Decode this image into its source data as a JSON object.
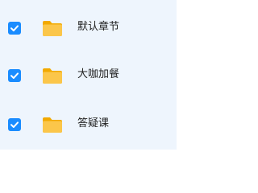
{
  "items": [
    {
      "label": "默认章节",
      "checked": true,
      "icon": "folder-icon"
    },
    {
      "label": "大咖加餐",
      "checked": true,
      "icon": "folder-icon"
    },
    {
      "label": "答疑课",
      "checked": true,
      "icon": "folder-icon"
    }
  ],
  "colors": {
    "panel_bg": "#eef5fd",
    "checkbox_bg": "#1a8cff",
    "folder_front": "#fbc64a",
    "folder_back": "#f2a900",
    "text": "#222222"
  }
}
